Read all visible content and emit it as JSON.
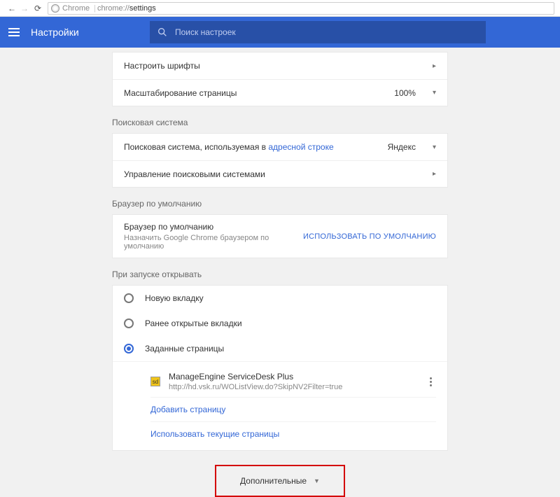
{
  "browser_bar": {
    "chrome_label": "Chrome",
    "url_prefix": "chrome://",
    "url_path": "settings"
  },
  "header": {
    "title": "Настройки",
    "search_placeholder": "Поиск настроек"
  },
  "appearance": {
    "fonts_label": "Настроить шрифты",
    "zoom_label": "Масштабирование страницы",
    "zoom_value": "100%"
  },
  "search_engine": {
    "section_title": "Поисковая система",
    "row1_prefix": "Поисковая система, используемая в ",
    "row1_link": "адресной строке",
    "engine_value": "Яндекс",
    "row2_label": "Управление поисковыми системами"
  },
  "default_browser": {
    "section_title": "Браузер по умолчанию",
    "title": "Браузер по умолчанию",
    "subtitle": "Назначить Google Chrome браузером по умолчанию",
    "button": "ИСПОЛЬЗОВАТЬ ПО УМОЛЧАНИЮ"
  },
  "startup": {
    "section_title": "При запуске открывать",
    "opt1": "Новую вкладку",
    "opt2": "Ранее открытые вкладки",
    "opt3": "Заданные страницы",
    "page": {
      "title": "ManageEngine ServiceDesk Plus",
      "url": "http://hd.vsk.ru/WOListView.do?SkipNV2Filter=true"
    },
    "add_page": "Добавить страницу",
    "use_current": "Использовать текущие страницы"
  },
  "advanced": {
    "label": "Дополнительные"
  }
}
